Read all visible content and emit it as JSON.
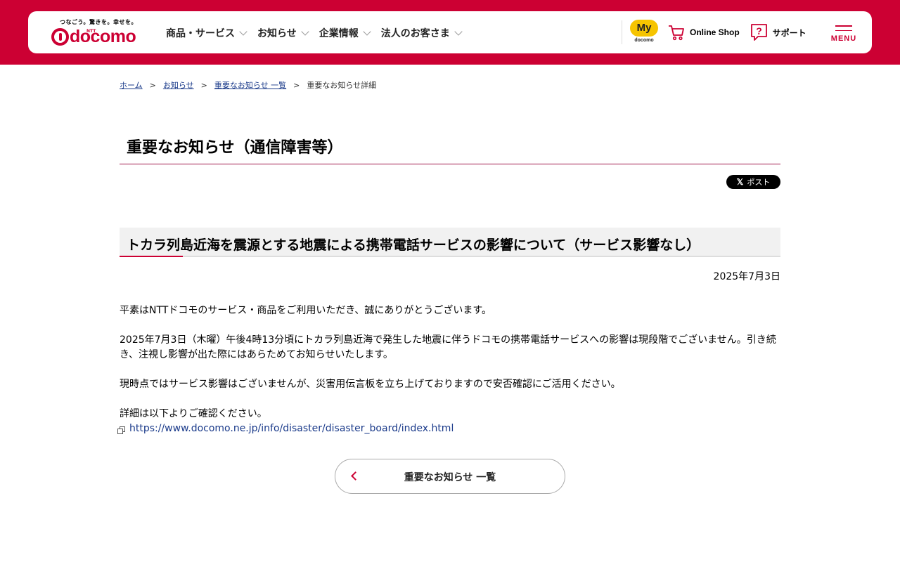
{
  "header": {
    "tagline": "つなごう。驚きを。幸せを。",
    "logo_ntt": "NTT",
    "logo_brand": "docomo",
    "nav": [
      {
        "label": "商品・サービス"
      },
      {
        "label": "お知らせ"
      },
      {
        "label": "企業情報"
      },
      {
        "label": "法人のお客さま"
      }
    ],
    "my_badge": "My",
    "my_sub": "docomo",
    "online_shop": "Online Shop",
    "support": "サポート",
    "menu": "MENU",
    "accent_color": "#cc0033"
  },
  "breadcrumb": {
    "items": [
      {
        "label": "ホーム"
      },
      {
        "label": "お知らせ"
      },
      {
        "label": "重要なお知らせ 一覧"
      }
    ],
    "separator": ">",
    "current": "重要なお知らせ詳細"
  },
  "page": {
    "title": "重要なお知らせ（通信障害等）",
    "post_button": "ポスト",
    "heading": "トカラ列島近海を震源とする地震による携帯電話サービスの影響について（サービス影響なし）",
    "date": "2025年7月3日",
    "paragraphs": [
      "平素はNTTドコモのサービス・商品をご利用いただき、誠にありがとうございます。",
      "2025年7月3日（木曜）午後4時13分頃にトカラ列島近海で発生した地震に伴うドコモの携帯電話サービスへの影響は現段階でございません。引き続き、注視し影響が出た際にはあらためてお知らせいたします。",
      "現時点ではサービス影響はございませんが、災害用伝言板を立ち上げておりますので安否確認にご活用ください。",
      "詳細は以下よりご確認ください。"
    ],
    "link": "https://www.docomo.ne.jp/info/disaster/disaster_board/index.html",
    "back_button": "重要なお知らせ 一覧"
  }
}
